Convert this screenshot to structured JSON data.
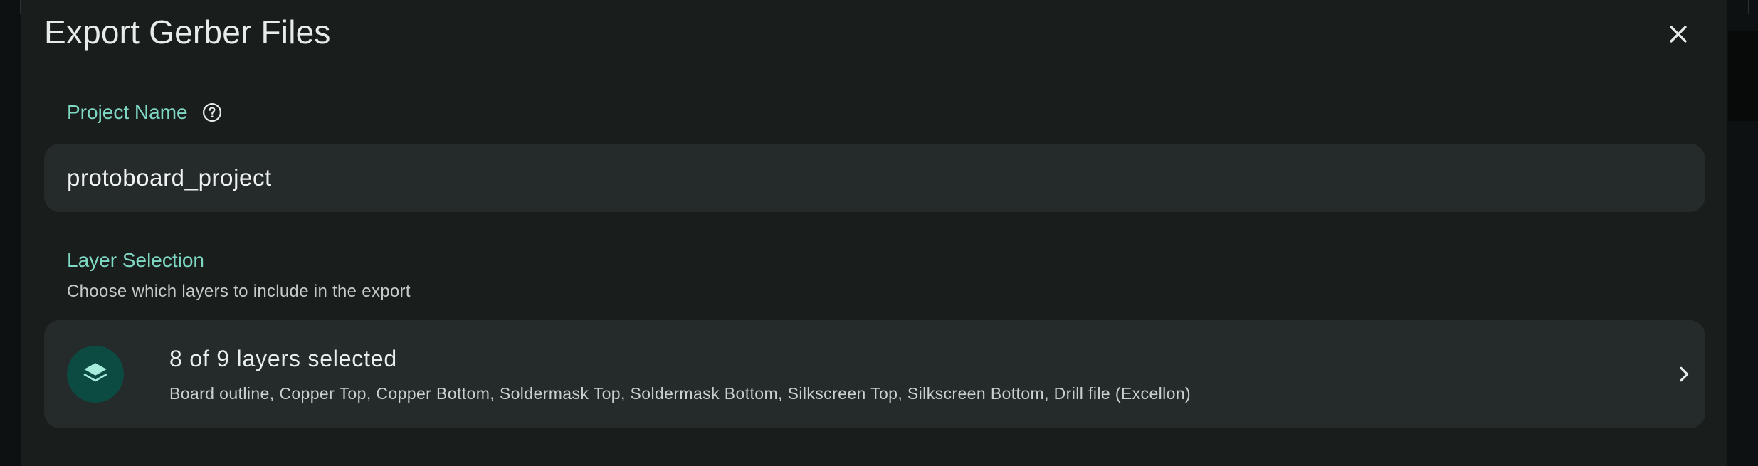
{
  "dialog": {
    "title": "Export Gerber Files"
  },
  "project_name": {
    "label": "Project Name",
    "value": "protoboard_project"
  },
  "layer_selection": {
    "title": "Layer Selection",
    "description": "Choose which layers to include in the export",
    "summary": "8 of 9 layers selected",
    "selected_layers_text": "Board outline, Copper Top, Copper Bottom, Soldermask Top, Soldermask Bottom, Silkscreen Top, Silkscreen Bottom, Drill file (Excellon)"
  },
  "icons": {
    "close": "close-icon",
    "help": "help-circle-icon",
    "layers": "layers-icon",
    "chevron": "chevron-right-icon"
  },
  "colors": {
    "accent": "#7ed8c4",
    "dialog_bg": "#191d1c",
    "field_bg": "#252b2b",
    "avatar_bg": "#0b4b42"
  }
}
